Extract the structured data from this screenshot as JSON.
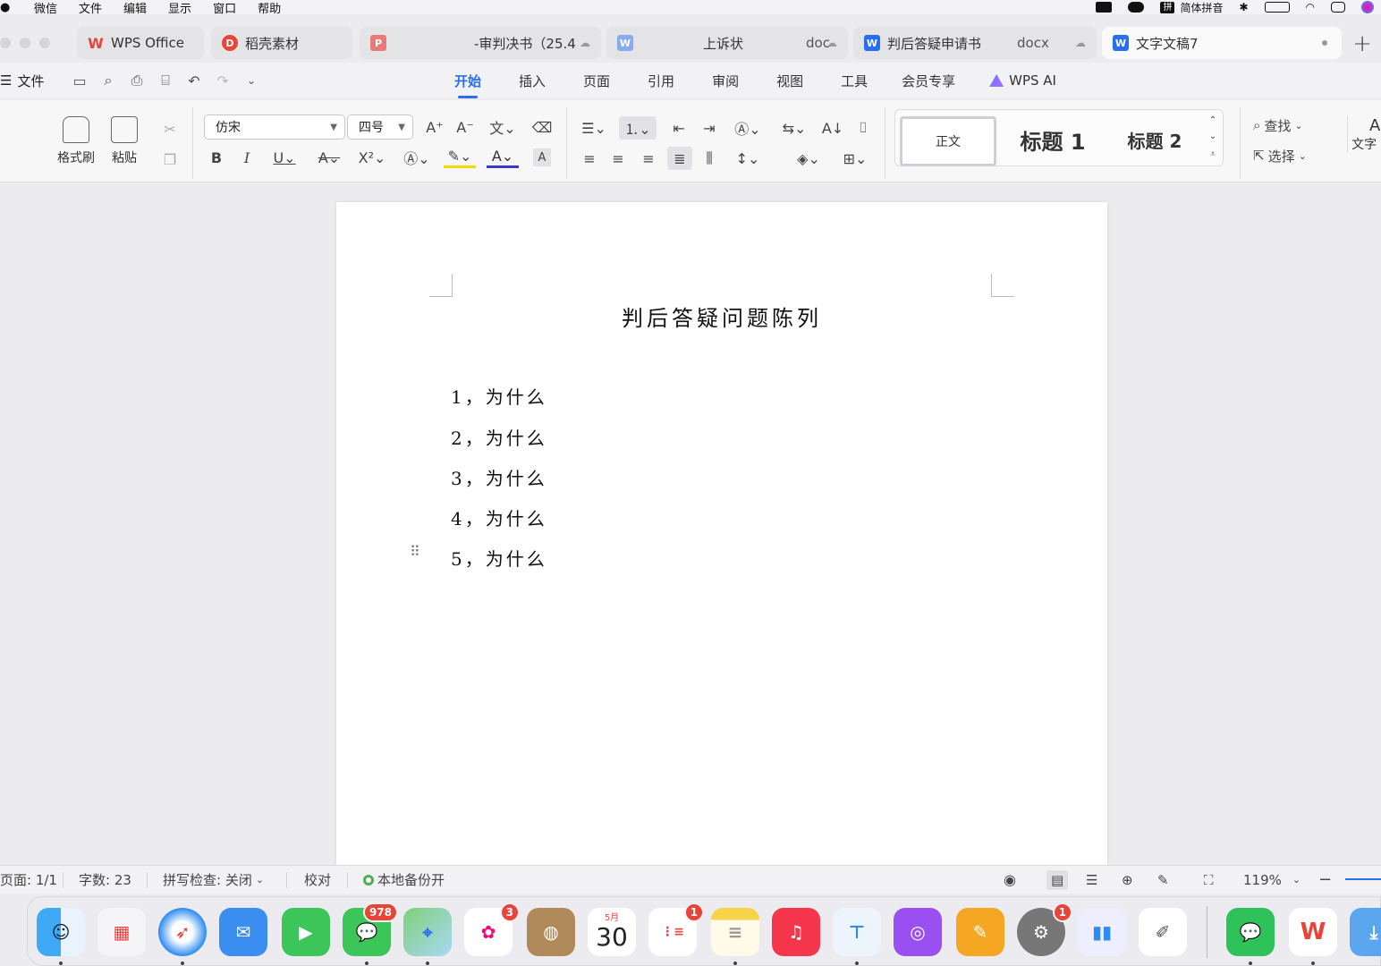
{
  "menubar": {
    "items": [
      "微信",
      "文件",
      "编辑",
      "显示",
      "窗口",
      "帮助"
    ],
    "ime_label": "简体拼音",
    "ime_box": "拼"
  },
  "tabs": [
    {
      "label": "WPS Office",
      "icon": "W",
      "color": "#e8443a"
    },
    {
      "label": "稻壳素材",
      "icon": "D",
      "color": "#e8443a"
    },
    {
      "label": "-审判决书（25.4",
      "icon": "P",
      "color": "#e87a7a"
    },
    {
      "label": "上诉状",
      "suffix": "doc",
      "icon": "W",
      "color": "#8aaaf0"
    },
    {
      "label": "判后答疑申请书",
      "suffix": "docx",
      "icon": "W",
      "color": "#2a6ef0"
    },
    {
      "label": "文字文稿7",
      "icon": "W",
      "color": "#2a6ef0"
    }
  ],
  "ribbon": {
    "file_label": "文件",
    "tabs": [
      "开始",
      "插入",
      "页面",
      "引用",
      "审阅",
      "视图",
      "工具",
      "会员专享"
    ],
    "active_tab": "开始",
    "ai_label": "WPS AI"
  },
  "toolbar": {
    "format_painter": "格式刷",
    "paste": "粘贴",
    "font_name": "仿宋",
    "font_size": "四号",
    "styles": {
      "normal": "正文",
      "h1": "标题 1",
      "h2": "标题 2"
    },
    "find": "查找",
    "select": "选择",
    "text_tools": "文字"
  },
  "document": {
    "title": "判后答疑问题陈列",
    "lines": [
      "1，为什么",
      "2，为什么",
      "3，为什么",
      "4，为什么",
      "5，为什么"
    ]
  },
  "statusbar": {
    "page": "页面: 1/1",
    "word_count": "字数: 23",
    "spell_check": "拼写检查: 关闭",
    "proofread": "校对",
    "backup": "本地备份开",
    "zoom": "119%"
  },
  "dock": {
    "badges": {
      "messages": "978",
      "photos": "3",
      "reminders": "1",
      "settings": "1"
    },
    "calendar_month": "5月",
    "calendar_day": "30"
  }
}
